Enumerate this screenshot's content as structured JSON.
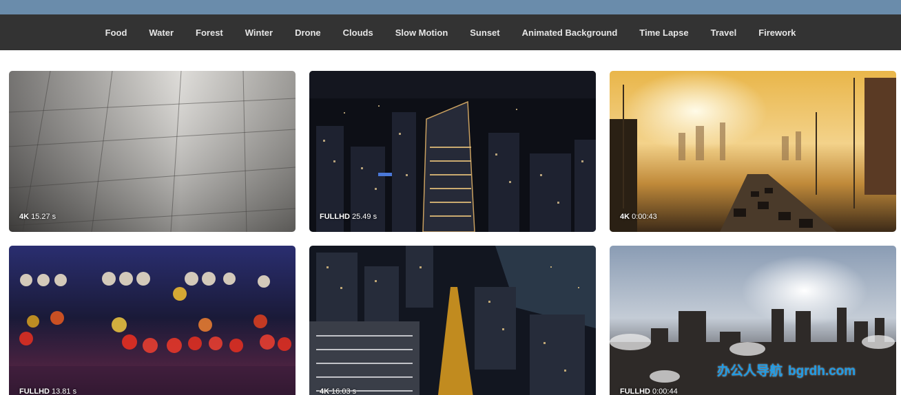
{
  "nav": {
    "items": [
      "Food",
      "Water",
      "Forest",
      "Winter",
      "Drone",
      "Clouds",
      "Slow Motion",
      "Sunset",
      "Animated Background",
      "Time Lapse",
      "Travel",
      "Firework"
    ]
  },
  "videos": [
    {
      "quality": "4K",
      "duration": "15.27 s",
      "scene": "rain-on-pavement"
    },
    {
      "quality": "FULLHD",
      "duration": "25.49 s",
      "scene": "night-city-aerial"
    },
    {
      "quality": "4K",
      "duration": "0:00:43",
      "scene": "sunset-highway"
    },
    {
      "quality": "FULLHD",
      "duration": "13.81 s",
      "scene": "bokeh-lights"
    },
    {
      "quality": "4K",
      "duration": "16.03 s",
      "scene": "night-harbor-city"
    },
    {
      "quality": "FULLHD",
      "duration": "0:00:44",
      "scene": "sunrise-skyline"
    }
  ],
  "watermark": {
    "cn": "办公人导航",
    "site": "bgrdh.com"
  },
  "colors": {
    "topband": "#6a8cab",
    "navbar": "#333333",
    "nav_text": "#e6e6e6",
    "watermark": "#1e9be6"
  }
}
